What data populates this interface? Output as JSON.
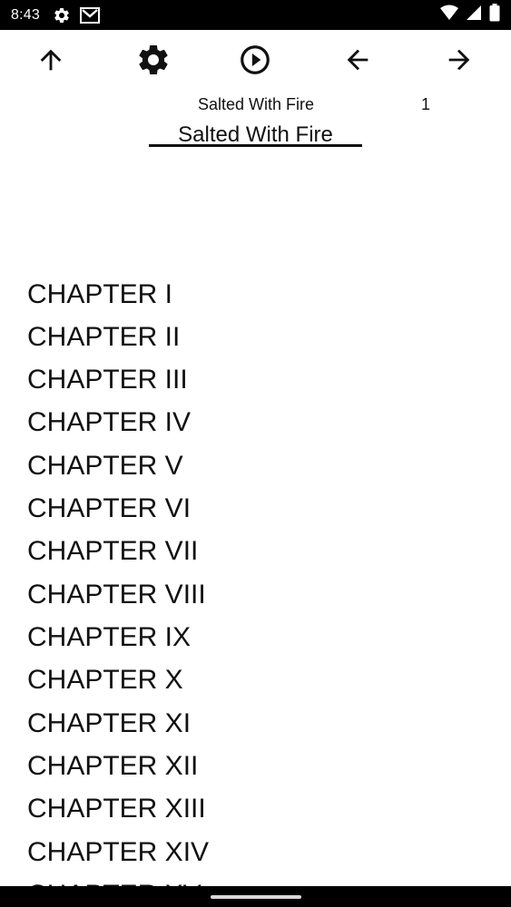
{
  "status_bar": {
    "time": "8:43",
    "icons_left": [
      "gear-icon",
      "gmail-icon"
    ],
    "icons_right": [
      "wifi-icon",
      "signal-icon",
      "battery-icon"
    ]
  },
  "toolbar": {
    "buttons": [
      {
        "name": "up-arrow-icon",
        "action": "up"
      },
      {
        "name": "gear-icon",
        "action": "settings"
      },
      {
        "name": "play-icon",
        "action": "play"
      },
      {
        "name": "arrow-left-icon",
        "action": "previous"
      },
      {
        "name": "arrow-right-icon",
        "action": "next"
      }
    ]
  },
  "header": {
    "title": "Salted With Fire",
    "page": "1"
  },
  "book": {
    "title": "Salted With Fire"
  },
  "chapters": [
    {
      "label": "CHAPTER I"
    },
    {
      "label": "CHAPTER II"
    },
    {
      "label": "CHAPTER III"
    },
    {
      "label": "CHAPTER IV"
    },
    {
      "label": "CHAPTER V"
    },
    {
      "label": "CHAPTER VI"
    },
    {
      "label": "CHAPTER VII"
    },
    {
      "label": "CHAPTER VIII"
    },
    {
      "label": "CHAPTER IX"
    },
    {
      "label": "CHAPTER X"
    },
    {
      "label": "CHAPTER XI"
    },
    {
      "label": "CHAPTER XII"
    },
    {
      "label": "CHAPTER XIII"
    },
    {
      "label": "CHAPTER XIV"
    },
    {
      "label": "CHAPTER XV"
    }
  ]
}
